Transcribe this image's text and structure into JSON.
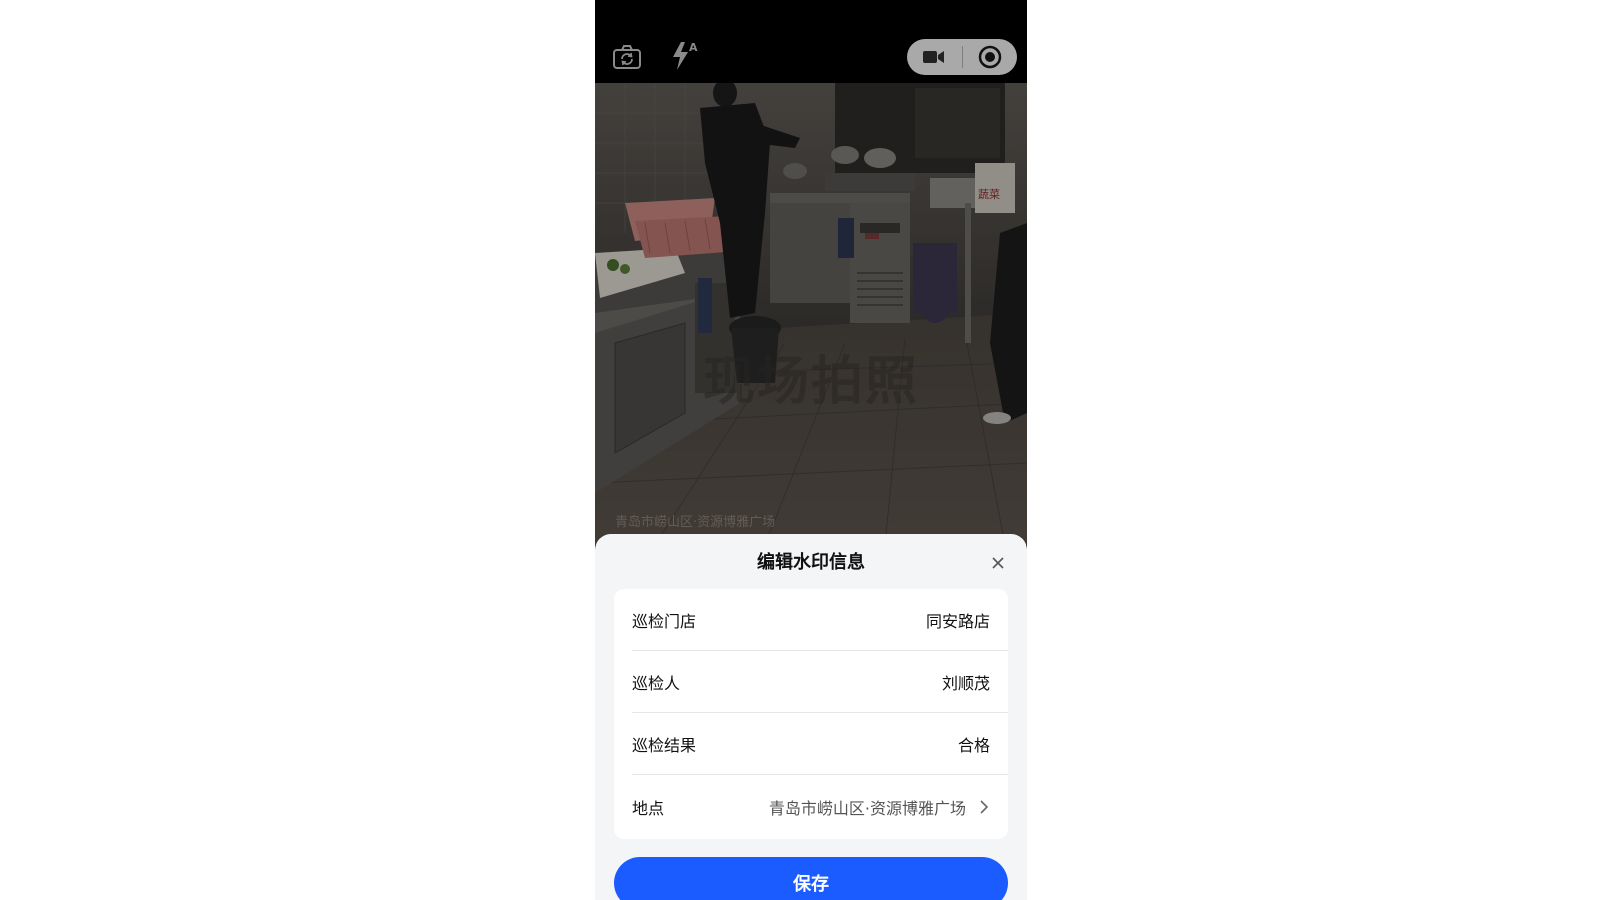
{
  "camera": {
    "icons": {
      "flip": "camera-switch-icon",
      "flash": "flash-auto-icon",
      "video": "video-camera-icon",
      "photo": "shutter-record-icon"
    }
  },
  "viewfinder": {
    "watermark_text": "现场拍照",
    "location_overlay": "青岛市崂山区·资源博雅广场"
  },
  "sheet": {
    "title": "编辑水印信息",
    "rows": [
      {
        "label": "巡检门店",
        "value": "同安路店"
      },
      {
        "label": "巡检人",
        "value": "刘顺茂"
      },
      {
        "label": "巡检结果",
        "value": "合格"
      },
      {
        "label": "地点",
        "value": "青岛市崂山区·资源博雅广场"
      }
    ],
    "save_label": "保存"
  },
  "colors": {
    "primary": "#1a5cff",
    "sheet_bg": "#f4f5f7",
    "card_bg": "#ffffff"
  }
}
